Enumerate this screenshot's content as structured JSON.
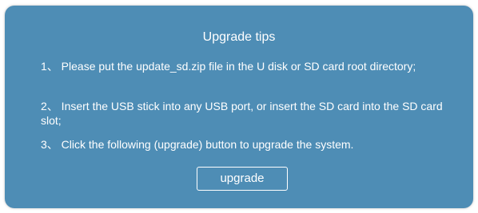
{
  "dialog": {
    "title": "Upgrade tips",
    "tips": [
      "1、 Please put the update_sd.zip file in the U disk or SD card root directory;",
      "2、 Insert the USB stick into any USB port, or insert the SD card into the SD card slot;",
      "3、 Click the following (upgrade) button to upgrade the system."
    ],
    "button_label": "upgrade"
  },
  "colors": {
    "dialog_background": "#4e8db5",
    "text": "#ffffff",
    "button_border": "#ffffff"
  }
}
